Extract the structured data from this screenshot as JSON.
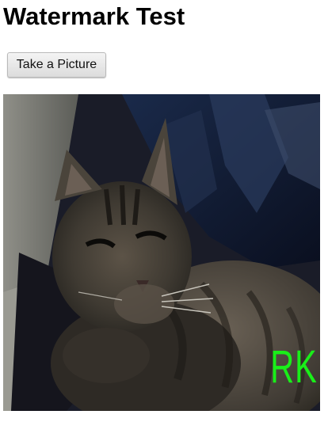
{
  "page": {
    "title": "Watermark Test"
  },
  "actions": {
    "take_picture_label": "Take a Picture"
  },
  "photo": {
    "subject": "cat",
    "watermark_text": "RK",
    "watermark_color": "#19ef19"
  }
}
